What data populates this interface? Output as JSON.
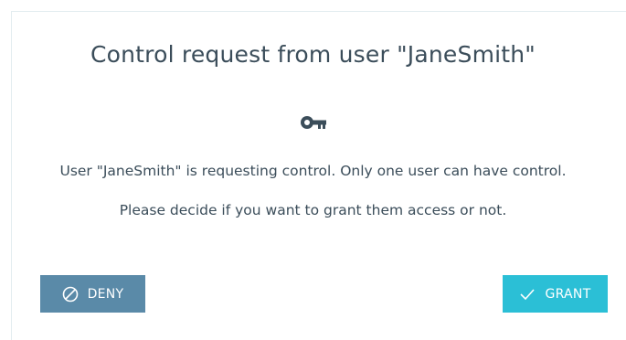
{
  "dialog": {
    "title": "Control request from user \"JaneSmith\"",
    "icon": "key-icon",
    "message_line1": "User \"JaneSmith\" is requesting control. Only one user can have control.",
    "message_line2": "Please decide if you want to grant them access or not."
  },
  "actions": {
    "deny_label": "DENY",
    "deny_icon": "prohibited-icon",
    "grant_label": "GRANT",
    "grant_icon": "checkmark-icon"
  },
  "colors": {
    "text": "#3b4d5a",
    "deny_button": "#5a8aa8",
    "grant_button": "#2bbfd6",
    "border": "#e3ecf0"
  }
}
